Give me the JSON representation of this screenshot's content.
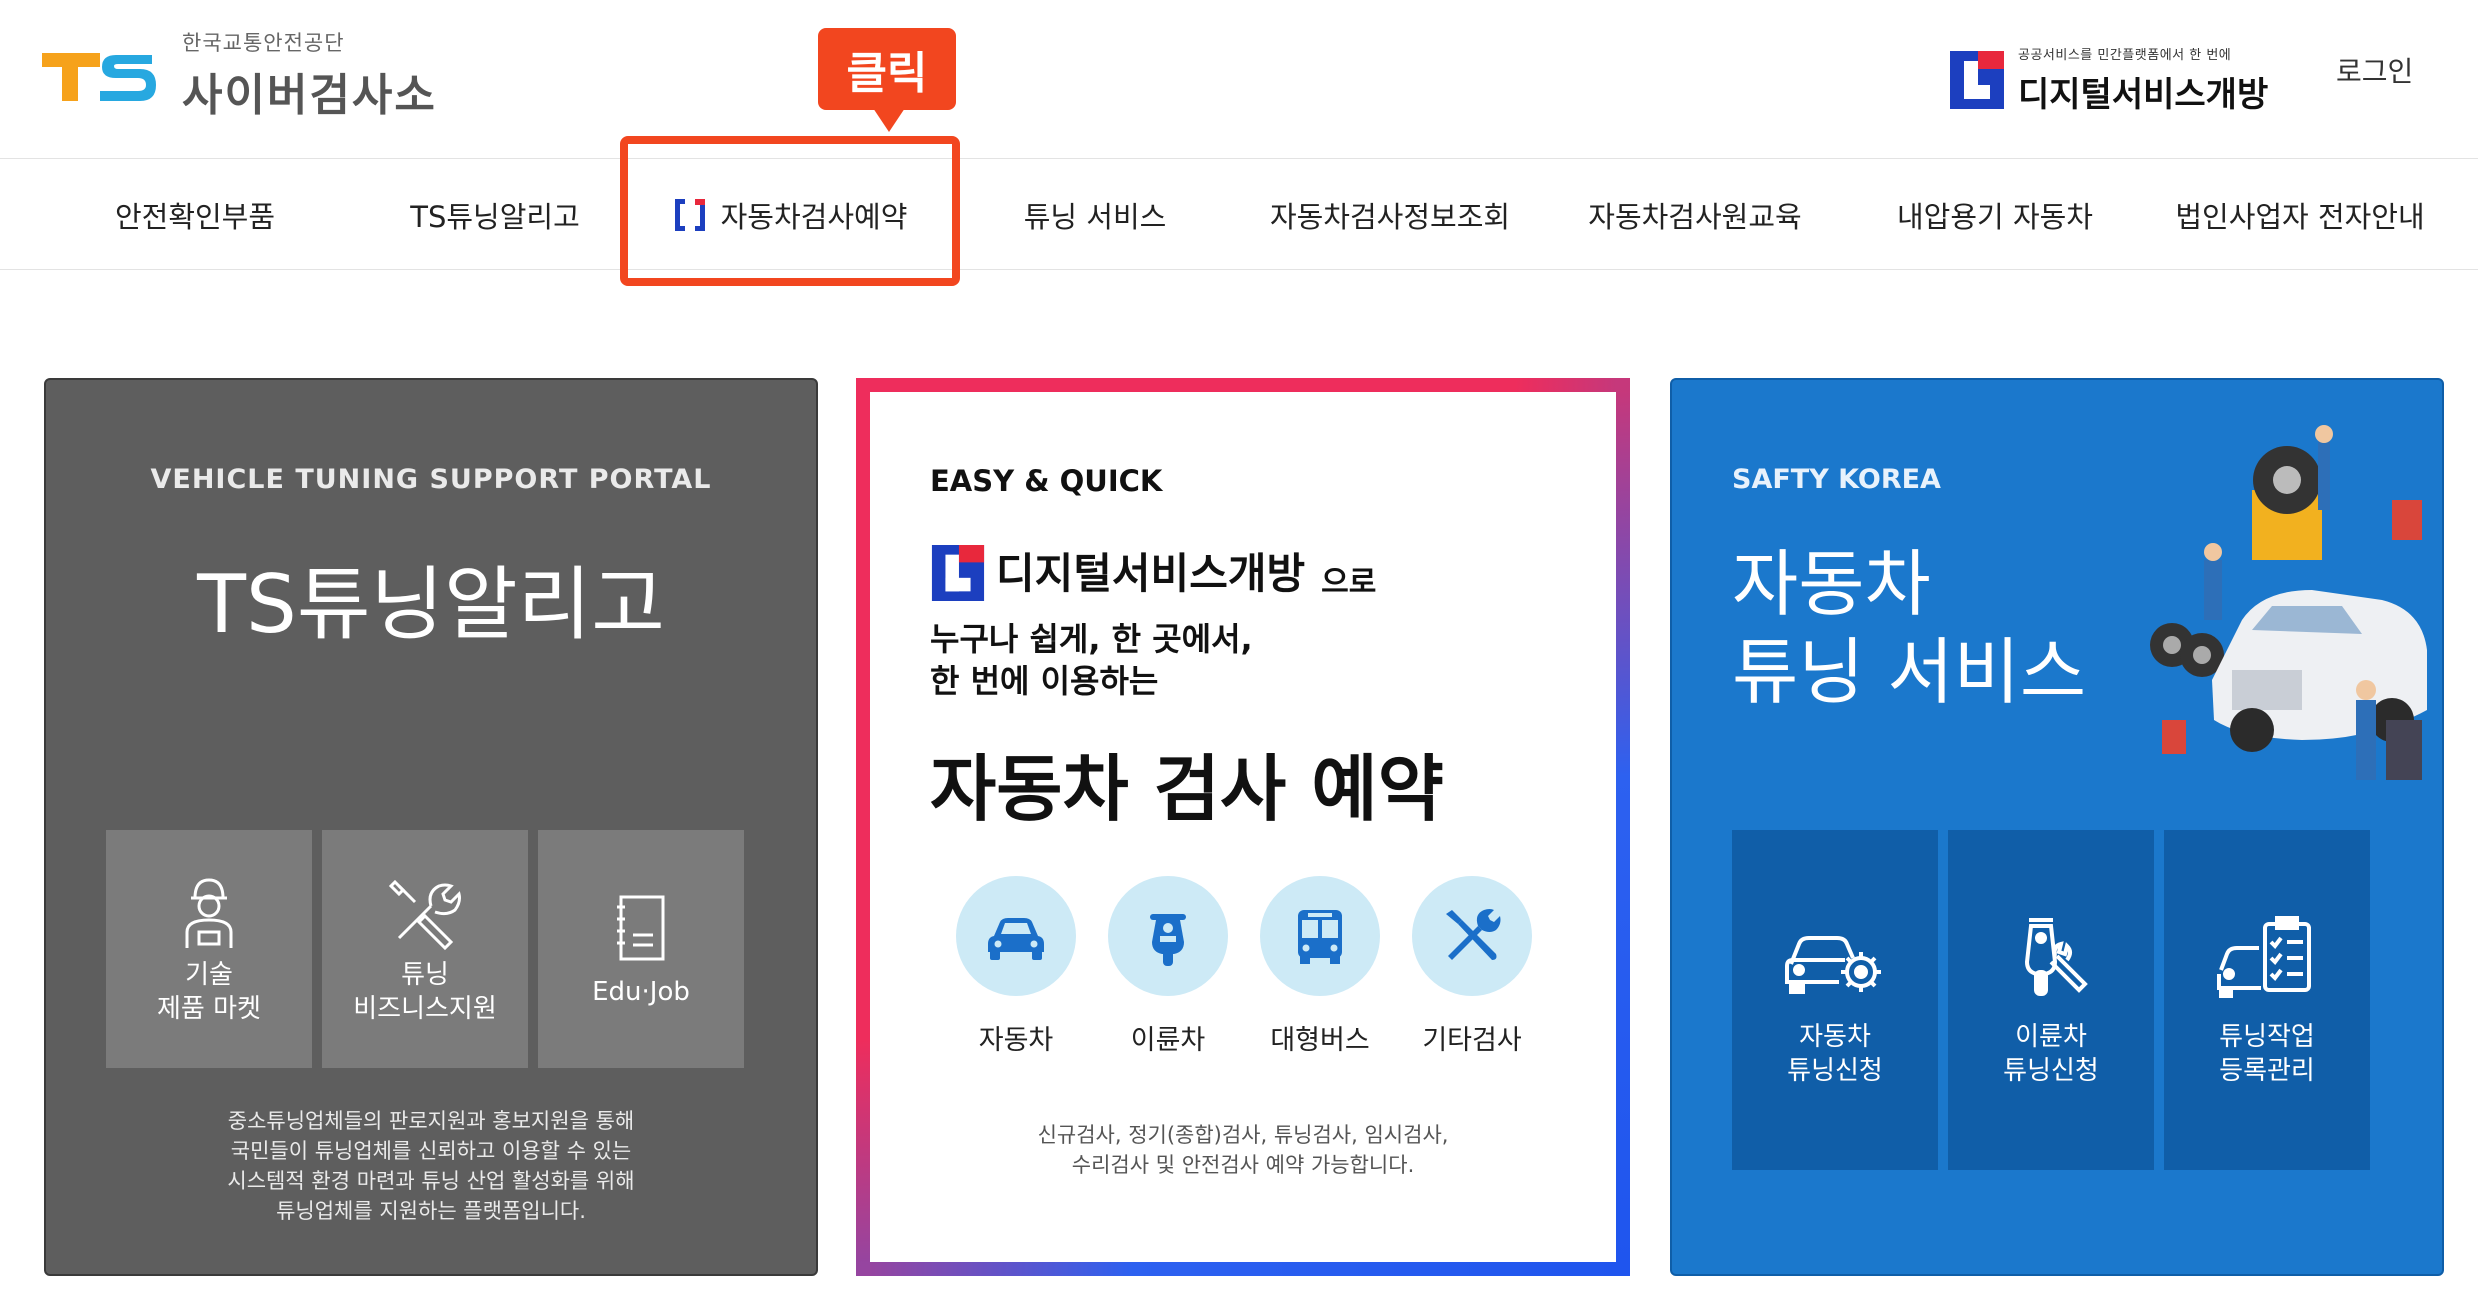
{
  "header": {
    "org_sub": "한국교통안전공단",
    "site_name": "사이버검사소",
    "dso_small": "공공서비스를 민간플랫폼에서 한 번에",
    "dso_big": "디지털서비스개방",
    "login_label": "로그인",
    "tooltip": "클릭"
  },
  "nav": {
    "items": [
      {
        "label": "안전확인부품"
      },
      {
        "label": "TS튜닝알리고"
      },
      {
        "label": "자동차검사예약"
      },
      {
        "label": "튜닝 서비스"
      },
      {
        "label": "자동차검사정보조회"
      },
      {
        "label": "자동차검사원교육"
      },
      {
        "label": "내압용기 자동차"
      },
      {
        "label": "법인사업자 전자안내"
      }
    ]
  },
  "gray_panel": {
    "kicker": "VEHICLE TUNING SUPPORT PORTAL",
    "title": "TS튜닝알리고",
    "tiles": [
      {
        "line1": "기술",
        "line2": "제품 마켓"
      },
      {
        "line1": "튜닝",
        "line2": "비즈니스지원"
      },
      {
        "line1": "Edu·Job",
        "line2": ""
      }
    ],
    "desc": [
      "중소튜닝업체들의 판로지원과 홍보지원을 통해",
      "국민들이 튜닝업체를 신뢰하고 이용할 수 있는",
      "시스템적 환경 마련과 튜닝 산업 활성화를 위해",
      "튜닝업체를 지원하는 플랫폼입니다."
    ]
  },
  "white_panel": {
    "kicker": "EASY & QUICK",
    "brand": "디지털서비스개방",
    "brand_suffix": "으로",
    "line1": "누구나 쉽게, 한 곳에서,",
    "line2": "한 번에 이용하는",
    "title": "자동차 검사 예약",
    "icons": [
      {
        "label": "자동차",
        "icon": "car-icon"
      },
      {
        "label": "이륜차",
        "icon": "motorcycle-icon"
      },
      {
        "label": "대형버스",
        "icon": "bus-icon"
      },
      {
        "label": "기타검사",
        "icon": "tools-icon"
      }
    ],
    "desc": [
      "신규검사, 정기(종합)검사, 튜닝검사, 임시검사,",
      "수리검사 및 안전검사 예약 가능합니다."
    ]
  },
  "blue_panel": {
    "kicker": "SAFTY KOREA",
    "title_line1": "자동차",
    "title_line2": "튜닝 서비스",
    "tiles": [
      {
        "line1": "자동차",
        "line2": "튜닝신청"
      },
      {
        "line1": "이륜차",
        "line2": "튜닝신청"
      },
      {
        "line1": "튜닝작업",
        "line2": "등록관리"
      }
    ]
  },
  "colors": {
    "highlight": "#f2461f",
    "gray_panel": "#5e5e5e",
    "blue_panel": "#1b78cc",
    "circle": "#cdeaf6"
  }
}
